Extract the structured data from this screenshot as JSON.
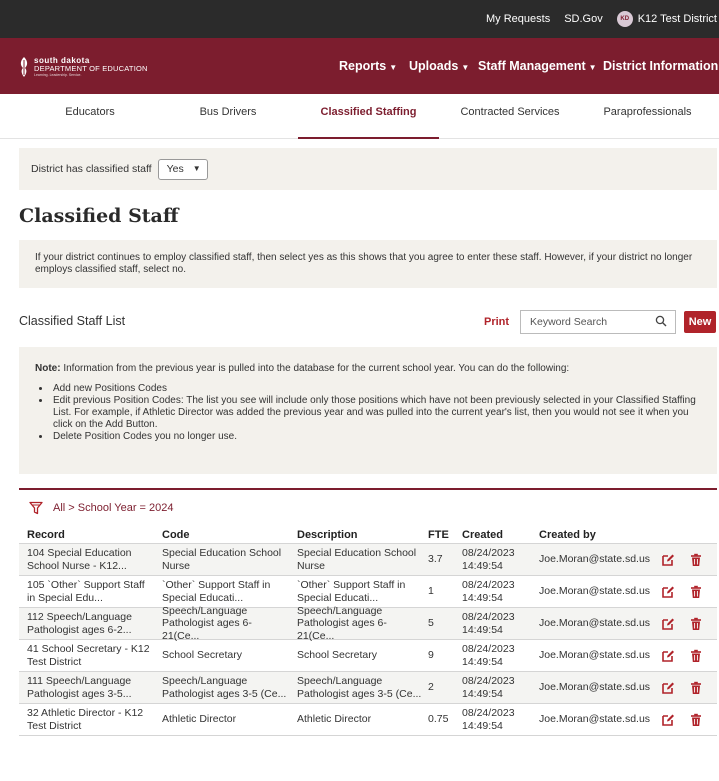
{
  "topbar": {
    "my_requests": "My Requests",
    "sd_gov": "SD.Gov",
    "avatar_initials": "KD",
    "district": "K12 Test District"
  },
  "logo": {
    "line1": "south dakota",
    "line2": "DEPARTMENT OF EDUCATION",
    "line3": "Learning. Leadership. Service."
  },
  "nav": [
    {
      "label": "Reports"
    },
    {
      "label": "Uploads"
    },
    {
      "label": "Staff Management"
    },
    {
      "label": "District Information"
    }
  ],
  "tabs": [
    {
      "label": "Educators",
      "active": false
    },
    {
      "label": "Bus Drivers",
      "active": false
    },
    {
      "label": "Classified Staffing",
      "active": true
    },
    {
      "label": "Contracted Services",
      "active": false
    },
    {
      "label": "Paraprofessionals",
      "active": false
    }
  ],
  "district_classified": {
    "label": "District has classified staff",
    "value": "Yes"
  },
  "page_title": "Classified Staff",
  "intro_text": "If your district continues to employ classified staff, then select yes as this shows that you agree to enter these staff. However, if your district no longer employs classified staff, select no.",
  "list": {
    "title": "Classified Staff List",
    "print_label": "Print",
    "search_placeholder": "Keyword Search",
    "new_label": "New"
  },
  "note": {
    "lead": "Note:",
    "text": " Information from the previous year is pulled into the database for the current school year. You can do the following:",
    "items": [
      "Add new Positions Codes",
      "Edit previous Position Codes: The list you see will include only those positions which have not been previously selected in your Classified Staffing List. For example, if Athletic Director was added the previous year and was pulled into the current year's list, then you would not see it when you click on the Add Button.",
      "Delete Position Codes you no longer use."
    ]
  },
  "filter": "All > School Year = 2024",
  "table": {
    "headers": [
      "Record",
      "Code",
      "Description",
      "FTE",
      "Created",
      "Created by"
    ],
    "rows": [
      {
        "record": "104 Special Education School Nurse - K12...",
        "code": "Special Education School Nurse",
        "description": "Special Education School Nurse",
        "fte": "3.7",
        "created": "08/24/2023 14:49:54",
        "created_by": "Joe.Moran@state.sd.us"
      },
      {
        "record": "105 `Other` Support Staff in Special Edu...",
        "code": "`Other` Support Staff in Special Educati...",
        "description": "`Other` Support Staff in Special Educati...",
        "fte": "1",
        "created": "08/24/2023 14:49:54",
        "created_by": "Joe.Moran@state.sd.us"
      },
      {
        "record": "112 Speech/Language Pathologist ages 6-2...",
        "code": "Speech/Language Pathologist ages 6-21(Ce...",
        "description": "Speech/Language Pathologist ages 6-21(Ce...",
        "fte": "5",
        "created": "08/24/2023 14:49:54",
        "created_by": "Joe.Moran@state.sd.us"
      },
      {
        "record": "41 School Secretary - K12 Test District",
        "code": "School Secretary",
        "description": "School Secretary",
        "fte": "9",
        "created": "08/24/2023 14:49:54",
        "created_by": "Joe.Moran@state.sd.us"
      },
      {
        "record": "111 Speech/Language Pathologist ages 3-5...",
        "code": "Speech/Language Pathologist ages 3-5 (Ce...",
        "description": "Speech/Language Pathologist ages 3-5 (Ce...",
        "fte": "2",
        "created": "08/24/2023 14:49:54",
        "created_by": "Joe.Moran@state.sd.us"
      },
      {
        "record": "32 Athletic Director - K12 Test District",
        "code": "Athletic Director",
        "description": "Athletic Director",
        "fte": "0.75",
        "created": "08/24/2023 14:49:54",
        "created_by": "Joe.Moran@state.sd.us"
      }
    ]
  },
  "colors": {
    "brand": "#7c1d2e",
    "accent_red": "#b0232a",
    "topbar": "#2b2b2b",
    "panel": "#f3f1ec"
  }
}
